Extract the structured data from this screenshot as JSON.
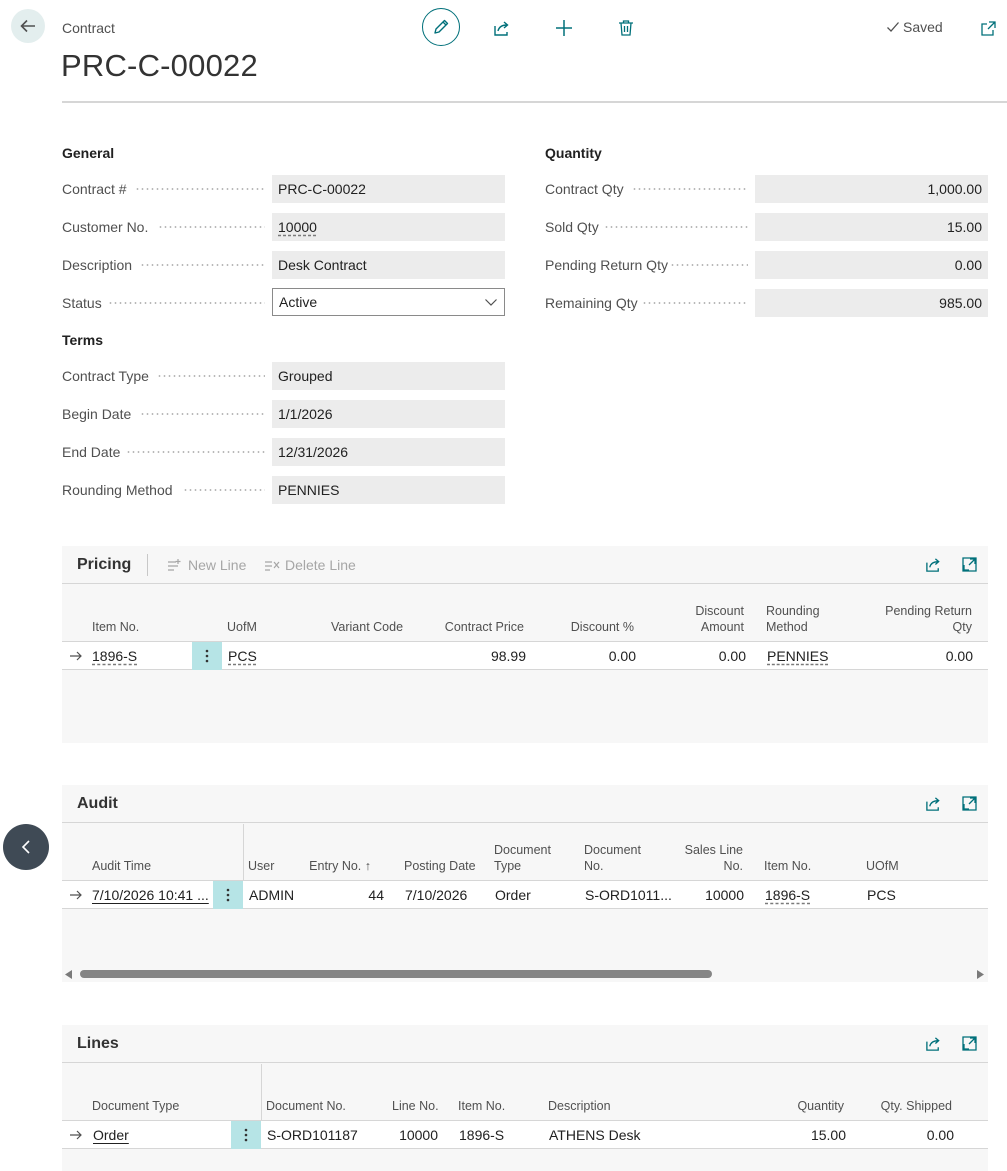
{
  "header": {
    "breadcrumb": "Contract",
    "title": "PRC-C-00022",
    "saved_label": "Saved",
    "icons": [
      "back-arrow-icon",
      "pencil-icon",
      "share-icon",
      "plus-icon",
      "trash-icon",
      "checkmark-icon",
      "open-new-window-icon"
    ],
    "accent_color": "#00707a"
  },
  "general": {
    "heading": "General",
    "contract_no_label": "Contract #",
    "contract_no": "PRC-C-00022",
    "customer_no_label": "Customer No.",
    "customer_no": "10000",
    "description_label": "Description",
    "description": "Desk Contract",
    "status_label": "Status",
    "status": "Active"
  },
  "terms": {
    "heading": "Terms",
    "contract_type_label": "Contract Type",
    "contract_type": "Grouped",
    "begin_date_label": "Begin Date",
    "begin_date": "1/1/2026",
    "end_date_label": "End Date",
    "end_date": "12/31/2026",
    "rounding_method_label": "Rounding Method",
    "rounding_method": "PENNIES"
  },
  "quantity": {
    "heading": "Quantity",
    "contract_qty_label": "Contract Qty",
    "contract_qty": "1,000.00",
    "sold_qty_label": "Sold Qty",
    "sold_qty": "15.00",
    "pending_return_qty_label": "Pending Return Qty",
    "pending_return_qty": "0.00",
    "remaining_qty_label": "Remaining Qty",
    "remaining_qty": "985.00"
  },
  "pricing": {
    "title": "Pricing",
    "new_line_label": "New Line",
    "delete_line_label": "Delete Line",
    "columns": {
      "item_no": "Item No.",
      "uofm": "UofM",
      "variant_code": "Variant Code",
      "contract_price": "Contract Price",
      "discount_pct": "Discount %",
      "discount_amount_1": "Discount",
      "discount_amount_2": "Amount",
      "rounding_method_1": "Rounding",
      "rounding_method_2": "Method",
      "pending_return_1": "Pending Return",
      "pending_return_2": "Qty"
    },
    "row": {
      "item_no": "1896-S",
      "uofm": "PCS",
      "variant_code": "",
      "contract_price": "98.99",
      "discount_pct": "0.00",
      "discount_amount": "0.00",
      "rounding_method": "PENNIES",
      "pending_return_qty": "0.00"
    }
  },
  "audit": {
    "title": "Audit",
    "columns": {
      "audit_time": "Audit Time",
      "user": "User",
      "entry_no": "Entry No. ↑",
      "posting_date": "Posting Date",
      "document_type_1": "Document",
      "document_type_2": "Type",
      "document_no_1": "Document",
      "document_no_2": "No.",
      "sales_line_no_1": "Sales Line",
      "sales_line_no_2": "No.",
      "item_no": "Item No.",
      "uofm": "UOfM"
    },
    "row": {
      "audit_time": "7/10/2026 10:41 ...",
      "user": "ADMIN",
      "entry_no": "44",
      "posting_date": "7/10/2026",
      "document_type": "Order",
      "document_no": "S-ORD1011...",
      "sales_line_no": "10000",
      "item_no": "1896-S",
      "uofm": "PCS"
    }
  },
  "lines": {
    "title": "Lines",
    "columns": {
      "document_type": "Document Type",
      "document_no": "Document No.",
      "line_no": "Line No.",
      "item_no": "Item No.",
      "description": "Description",
      "quantity": "Quantity",
      "qty_shipped": "Qty. Shipped"
    },
    "row": {
      "document_type": "Order",
      "document_no": "S-ORD101187",
      "line_no": "10000",
      "item_no": "1896-S",
      "description": "ATHENS Desk",
      "quantity": "15.00",
      "qty_shipped": "0.00"
    }
  }
}
